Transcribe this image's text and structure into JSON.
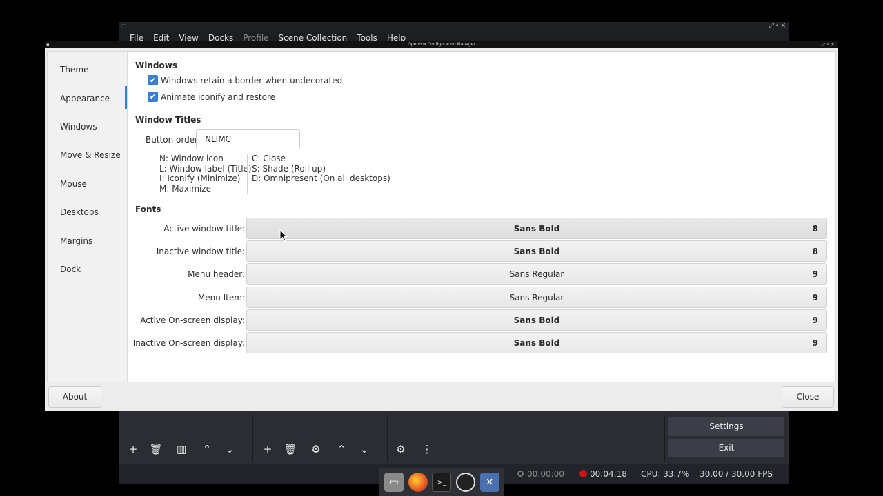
{
  "obs": {
    "menu": [
      "File",
      "Edit",
      "View",
      "Docks",
      "Profile",
      "Scene Collection",
      "Tools",
      "Help"
    ],
    "menu_disabled": [
      "Profile"
    ],
    "controls": {
      "settings_label": "Settings",
      "exit_label": "Exit"
    },
    "status": {
      "stream_time": "00:00:00",
      "rec_time": "00:04:18",
      "cpu": "CPU: 33.7%",
      "fps": "30.00 / 30.00 FPS"
    }
  },
  "obconf": {
    "title": "Openbox Configuration Manager",
    "sidebar": [
      {
        "label": "Theme"
      },
      {
        "label": "Appearance",
        "active": true
      },
      {
        "label": "Windows"
      },
      {
        "label": "Move & Resize"
      },
      {
        "label": "Mouse"
      },
      {
        "label": "Desktops"
      },
      {
        "label": "Margins"
      },
      {
        "label": "Dock"
      }
    ],
    "windows_section": {
      "title": "Windows",
      "retain_border_label": "Windows retain a border when undecorated",
      "retain_border_checked": true,
      "animate_label": "Animate iconify and restore",
      "animate_checked": true
    },
    "window_titles": {
      "title": "Window Titles",
      "button_order_label": "Button order:",
      "button_order_value": "NLIMC",
      "legend_left": [
        "N:  Window icon",
        "L:  Window label (Title)",
        "I:  Iconify (Minimize)",
        "M:  Maximize"
      ],
      "legend_right": [
        "C:  Close",
        "S:  Shade (Roll up)",
        "D:  Omnipresent (On all desktops)"
      ]
    },
    "fonts": {
      "title": "Fonts",
      "rows": [
        {
          "label": "Active window title:",
          "font": "Sans Bold",
          "size": "8",
          "bold": true
        },
        {
          "label": "Inactive window title:",
          "font": "Sans Bold",
          "size": "8",
          "bold": true
        },
        {
          "label": "Menu header:",
          "font": "Sans Regular",
          "size": "9",
          "bold": false
        },
        {
          "label": "Menu Item:",
          "font": "Sans Regular",
          "size": "9",
          "bold": false
        },
        {
          "label": "Active On-screen display:",
          "font": "Sans Bold",
          "size": "9",
          "bold": true
        },
        {
          "label": "Inactive On-screen display:",
          "font": "Sans Bold",
          "size": "9",
          "bold": true
        }
      ]
    },
    "about_label": "About",
    "close_label": "Close"
  },
  "colors": {
    "accent": "#3b7fd0",
    "rec": "#c9141a"
  },
  "taskbar_icons": [
    "file-manager-icon",
    "firefox-icon",
    "terminal-icon",
    "obs-icon",
    "obconf-icon"
  ]
}
